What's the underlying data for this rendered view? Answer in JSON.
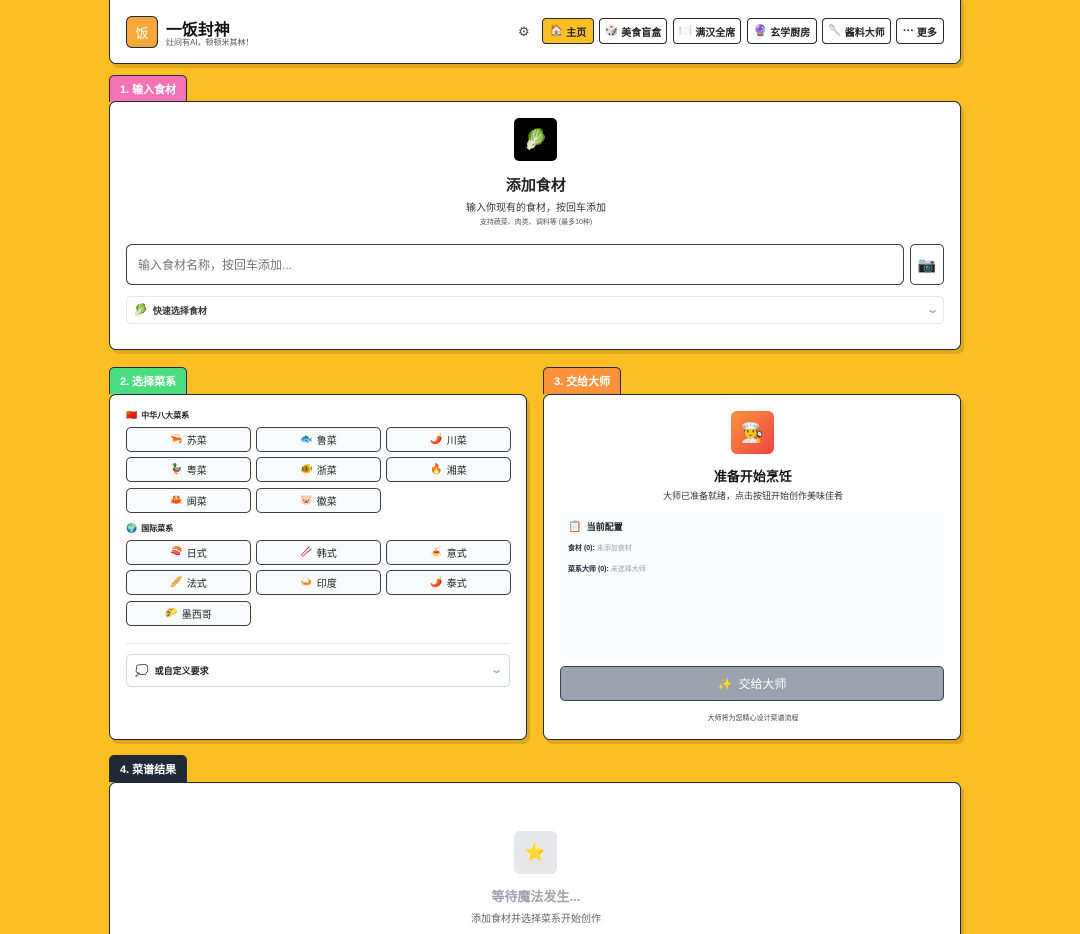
{
  "header": {
    "logo_char": "饭",
    "title": "一饭封神",
    "subtitle": "灶间有AI，顿顿米其林！",
    "nav": [
      {
        "icon": "🏠",
        "label": "主页"
      },
      {
        "icon": "🎲",
        "label": "美食盲盒"
      },
      {
        "icon": "🍽️",
        "label": "满汉全席"
      },
      {
        "icon": "🔮",
        "label": "玄学厨房"
      },
      {
        "icon": "🥄",
        "label": "酱料大师"
      },
      {
        "icon": "···",
        "label": "更多"
      }
    ]
  },
  "step1": {
    "tab": "1. 输入食材",
    "icon": "🥬",
    "title": "添加食材",
    "desc": "输入你现有的食材，按回车添加",
    "hint": "支持蔬菜、肉类、调料等 (最多10种)",
    "input_placeholder": "输入食材名称，按回车添加...",
    "camera_icon": "📷",
    "quick_icon": "🥬",
    "quick_label": "快速选择食材"
  },
  "step2": {
    "tab": "2. 选择菜系",
    "chinese_icon": "🇨🇳",
    "chinese_label": "中华八大菜系",
    "chinese": [
      {
        "icon": "🦐",
        "label": "苏菜"
      },
      {
        "icon": "🐟",
        "label": "鲁菜"
      },
      {
        "icon": "🌶️",
        "label": "川菜"
      },
      {
        "icon": "🦆",
        "label": "粤菜"
      },
      {
        "icon": "🐠",
        "label": "浙菜"
      },
      {
        "icon": "🔥",
        "label": "湘菜"
      },
      {
        "icon": "🦀",
        "label": "闽菜"
      },
      {
        "icon": "🐷",
        "label": "徽菜"
      }
    ],
    "intl_icon": "🌍",
    "intl_label": "国际菜系",
    "intl": [
      {
        "icon": "🍣",
        "label": "日式"
      },
      {
        "icon": "🥢",
        "label": "韩式"
      },
      {
        "icon": "🍝",
        "label": "意式"
      },
      {
        "icon": "🥖",
        "label": "法式"
      },
      {
        "icon": "🍛",
        "label": "印度"
      },
      {
        "icon": "🌶️",
        "label": "泰式"
      },
      {
        "icon": "🌮",
        "label": "墨西哥"
      }
    ],
    "custom_icon": "💭",
    "custom_label": "或自定义要求"
  },
  "step3": {
    "tab": "3. 交给大师",
    "icon": "👨‍🍳",
    "title": "准备开始烹饪",
    "desc": "大师已准备就绪，点击按钮开始创作美味佳肴",
    "config_icon": "📋",
    "config_title": "当前配置",
    "ingredients_label": "食材 (0):",
    "ingredients_value": "未添加食材",
    "cuisine_label": "菜系大师 (0):",
    "cuisine_value": "未选择大师",
    "button_icon": "✨",
    "button_label": "交给大师",
    "footnote": "大师将为您精心设计菜谱流程"
  },
  "step4": {
    "tab": "4. 菜谱结果",
    "icon": "⭐",
    "title": "等待魔法发生...",
    "desc": "添加食材并选择菜系开始创作"
  },
  "colors": {
    "background": "#fcbf23",
    "tab1": "#f472b6",
    "tab2": "#4ade80",
    "tab3": "#fb923c",
    "tab4": "#1f2937",
    "active_nav": "#fbbf24",
    "cta_disabled": "#9ca3af"
  }
}
